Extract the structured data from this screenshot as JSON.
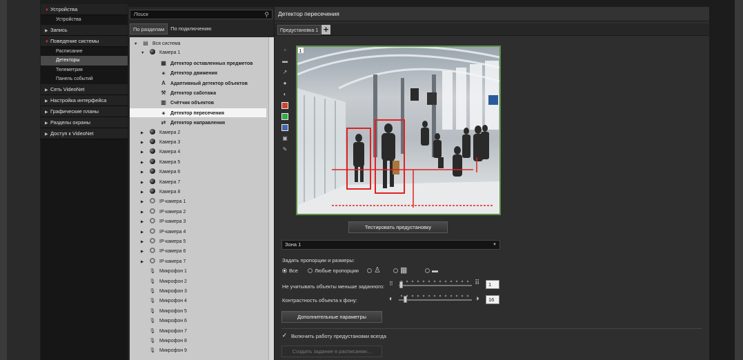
{
  "sidebar": {
    "sections": [
      {
        "label": "Устройства",
        "open": true,
        "items": [
          {
            "label": "Устройства",
            "active": false
          }
        ]
      },
      {
        "label": "Запись",
        "open": false,
        "items": []
      },
      {
        "label": "Поведение системы",
        "open": true,
        "items": [
          {
            "label": "Расписание",
            "active": false
          },
          {
            "label": "Детекторы",
            "active": true
          },
          {
            "label": "Телеметрия",
            "active": false
          },
          {
            "label": "Панель событий",
            "active": false
          }
        ]
      },
      {
        "label": "Сеть VideoNet",
        "open": false,
        "items": []
      },
      {
        "label": "Настройка интерфейса",
        "open": false,
        "items": []
      },
      {
        "label": "Графические планы",
        "open": false,
        "items": []
      },
      {
        "label": "Разделы охраны",
        "open": false,
        "items": []
      },
      {
        "label": "Доступ к VideoNet",
        "open": false,
        "items": []
      }
    ]
  },
  "tree_panel": {
    "search_placeholder": "Поиск",
    "tabs": [
      {
        "label": "По разделам",
        "active": true
      },
      {
        "label": "По подключению",
        "active": false
      }
    ],
    "rows": [
      {
        "label": "Вся система",
        "level": 0,
        "icon": "system-icon",
        "expanded": true,
        "bold": false,
        "selected": false
      },
      {
        "label": "Камера 1",
        "level": 1,
        "icon": "camera-icon",
        "expanded": true,
        "bold": false,
        "selected": false
      },
      {
        "label": "Детектор оставленных предметов",
        "level": 2,
        "icon": "abandoned-object-icon",
        "bold": true,
        "selected": false
      },
      {
        "label": "Детектор движения",
        "level": 2,
        "icon": "motion-icon",
        "bold": true,
        "selected": false
      },
      {
        "label": "Адаптивный детектор объектов",
        "level": 2,
        "icon": "adaptive-icon",
        "bold": true,
        "selected": false
      },
      {
        "label": "Детектор саботажа",
        "level": 2,
        "icon": "sabotage-icon",
        "bold": true,
        "selected": false
      },
      {
        "label": "Счётчик объектов",
        "level": 2,
        "icon": "counter-icon",
        "bold": true,
        "selected": false
      },
      {
        "label": "Детектор пересечения",
        "level": 2,
        "icon": "crossing-icon",
        "bold": true,
        "selected": true
      },
      {
        "label": "Детектор направления",
        "level": 2,
        "icon": "direction-icon",
        "bold": true,
        "selected": false
      },
      {
        "label": "Камера 2",
        "level": 1,
        "icon": "camera-icon",
        "expanded": false,
        "bold": false,
        "selected": false
      },
      {
        "label": "Камера 3",
        "level": 1,
        "icon": "camera-icon",
        "expanded": false,
        "bold": false,
        "selected": false
      },
      {
        "label": "Камера 4",
        "level": 1,
        "icon": "camera-icon",
        "expanded": false,
        "bold": false,
        "selected": false
      },
      {
        "label": "Камера 5",
        "level": 1,
        "icon": "camera-icon",
        "expanded": false,
        "bold": false,
        "selected": false
      },
      {
        "label": "Камера 6",
        "level": 1,
        "icon": "camera-icon",
        "expanded": false,
        "bold": false,
        "selected": false
      },
      {
        "label": "Камера 7",
        "level": 1,
        "icon": "camera-icon",
        "expanded": false,
        "bold": false,
        "selected": false
      },
      {
        "label": "Камера 8",
        "level": 1,
        "icon": "camera-icon",
        "expanded": false,
        "bold": false,
        "selected": false
      },
      {
        "label": "IP-камера 1",
        "level": 1,
        "icon": "ip-camera-icon",
        "expanded": false,
        "bold": false,
        "selected": false
      },
      {
        "label": "IP-камера 2",
        "level": 1,
        "icon": "ip-camera-icon",
        "expanded": false,
        "bold": false,
        "selected": false
      },
      {
        "label": "IP-камера 3",
        "level": 1,
        "icon": "ip-camera-icon",
        "expanded": false,
        "bold": false,
        "selected": false
      },
      {
        "label": "IP-камера 4",
        "level": 1,
        "icon": "ip-camera-icon",
        "expanded": false,
        "bold": false,
        "selected": false
      },
      {
        "label": "IP-камера 5",
        "level": 1,
        "icon": "ip-camera-icon",
        "expanded": false,
        "bold": false,
        "selected": false
      },
      {
        "label": "IP-камера 6",
        "level": 1,
        "icon": "ip-camera-icon",
        "expanded": false,
        "bold": false,
        "selected": false
      },
      {
        "label": "IP-камера 7",
        "level": 1,
        "icon": "ip-camera-icon",
        "expanded": false,
        "bold": false,
        "selected": false
      },
      {
        "label": "Микрофон 1",
        "level": 1,
        "icon": "microphone-icon",
        "bold": false,
        "selected": false
      },
      {
        "label": "Микрофон 2",
        "level": 1,
        "icon": "microphone-icon",
        "bold": false,
        "selected": false
      },
      {
        "label": "Микрофон 3",
        "level": 1,
        "icon": "microphone-icon",
        "bold": false,
        "selected": false
      },
      {
        "label": "Микрофон 4",
        "level": 1,
        "icon": "microphone-icon",
        "bold": false,
        "selected": false
      },
      {
        "label": "Микрофон 5",
        "level": 1,
        "icon": "microphone-icon",
        "bold": false,
        "selected": false
      },
      {
        "label": "Микрофон 6",
        "level": 1,
        "icon": "microphone-icon",
        "bold": false,
        "selected": false
      },
      {
        "label": "Микрофон 7",
        "level": 1,
        "icon": "microphone-icon",
        "bold": false,
        "selected": false
      },
      {
        "label": "Микрофон 8",
        "level": 1,
        "icon": "microphone-icon",
        "bold": false,
        "selected": false
      },
      {
        "label": "Микрофон 9",
        "level": 1,
        "icon": "microphone-icon",
        "bold": false,
        "selected": false
      }
    ]
  },
  "main": {
    "title": "Детектор пересечения",
    "preset_tab": "Предустановка 1",
    "preset_add": "+",
    "video_overlay_index": "1",
    "test_button": "Тестировать предустановку",
    "zone_value": "Зона 1",
    "proportions_label": "Задать пропорции и размеры:",
    "radio_all": "Все",
    "radio_any": "Любые пропорции",
    "min_size_label": "Не учитывать объекты меньше заданного:",
    "min_size_value": "1",
    "contrast_label": "Контрастность объекта к фону:",
    "contrast_value": "16",
    "advanced_button": "Дополнительные параметры",
    "always_on_label": "Включить работу предустановки всегда",
    "schedule_button": "Создать задание в расписании..."
  },
  "colors": {
    "accent_red": "#d33333",
    "video_border": "#5c8f4a"
  }
}
